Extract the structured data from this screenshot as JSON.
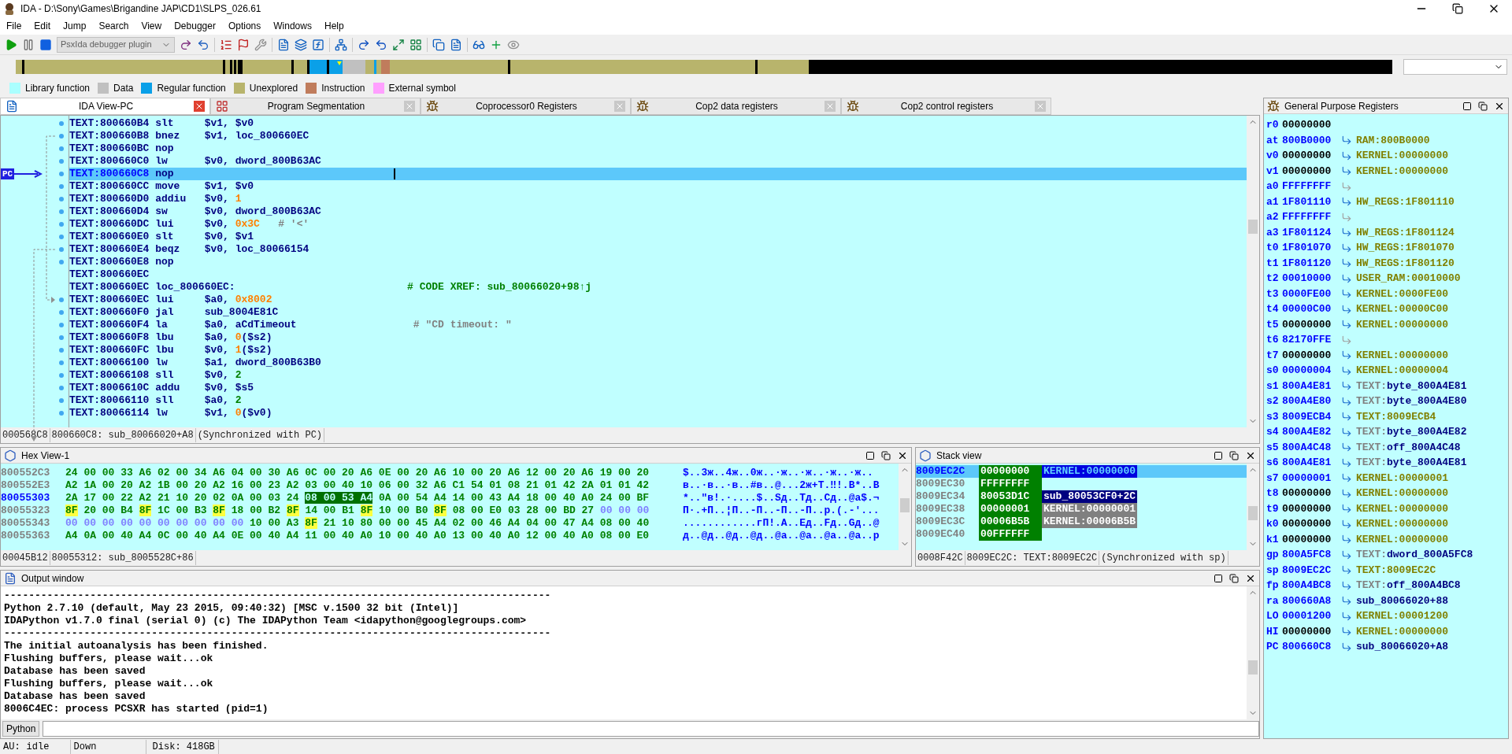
{
  "window": {
    "title": "IDA - D:\\Sony\\Games\\Brigandine JAP\\CD1\\SLPS_026.61"
  },
  "menu": [
    "File",
    "Edit",
    "Jump",
    "Search",
    "View",
    "Debugger",
    "Options",
    "Windows",
    "Help"
  ],
  "toolbar": {
    "debugger_select": {
      "value": "PsxIda debugger plugin",
      "disabled": true
    }
  },
  "legend": [
    {
      "label": "Library function",
      "color": "#aaffff"
    },
    {
      "label": "Data",
      "color": "#c0c0c0"
    },
    {
      "label": "Regular function",
      "color": "#0aa0e8"
    },
    {
      "label": "Unexplored",
      "color": "#b8b46c"
    },
    {
      "label": "Instruction",
      "color": "#c07c5c"
    },
    {
      "label": "External symbol",
      "color": "#ffa0ff"
    }
  ],
  "tabs": [
    {
      "label": "IDA View-PC",
      "selected": true,
      "kind": "disassembly"
    },
    {
      "label": "Program Segmentation",
      "selected": false,
      "kind": "segments"
    },
    {
      "label": "Coprocessor0 Registers",
      "selected": false,
      "kind": "registers"
    },
    {
      "label": "Cop2 data registers",
      "selected": false,
      "kind": "registers"
    },
    {
      "label": "Cop2 control registers",
      "selected": false,
      "kind": "registers"
    }
  ],
  "disassembly": {
    "pc_label": "PC",
    "lines": [
      {
        "address": "TEXT:800660B4",
        "mnemonic": "slt",
        "operands": [
          {
            "text": "$v1, $v0",
            "kind": "text"
          }
        ],
        "selected": false
      },
      {
        "address": "TEXT:800660B8",
        "mnemonic": "bnez",
        "operands": [
          {
            "text": "$v1, loc_800660EC",
            "kind": "text"
          }
        ],
        "selected": false
      },
      {
        "address": "TEXT:800660BC",
        "mnemonic": "nop",
        "selected": false
      },
      {
        "address": "TEXT:800660C0",
        "mnemonic": "lw",
        "operands": [
          {
            "text": "$v0, dword_800B63AC",
            "kind": "text"
          }
        ],
        "selected": false
      },
      {
        "address": "TEXT:800660C8",
        "mnemonic": "nop",
        "selected": true
      },
      {
        "address": "TEXT:800660CC",
        "mnemonic": "move",
        "operands": [
          {
            "text": "$v1, $v0",
            "kind": "text"
          }
        ],
        "selected": false
      },
      {
        "address": "TEXT:800660D0",
        "mnemonic": "addiu",
        "operands": [
          {
            "text": "$v0, ",
            "kind": "text"
          },
          {
            "text": "1",
            "kind": "number"
          }
        ],
        "selected": false
      },
      {
        "address": "TEXT:800660D4",
        "mnemonic": "sw",
        "operands": [
          {
            "text": "$v0, dword_800B63AC",
            "kind": "text"
          }
        ],
        "selected": false
      },
      {
        "address": "TEXT:800660DC",
        "mnemonic": "lui",
        "operands": [
          {
            "text": "$v0, ",
            "kind": "text"
          },
          {
            "text": "0x3C",
            "kind": "number"
          }
        ],
        "comment": {
          "text": "# '<'",
          "kind": "char"
        },
        "selected": false
      },
      {
        "address": "TEXT:800660E0",
        "mnemonic": "slt",
        "operands": [
          {
            "text": "$v0, $v1",
            "kind": "text"
          }
        ],
        "selected": false
      },
      {
        "address": "TEXT:800660E4",
        "mnemonic": "beqz",
        "operands": [
          {
            "text": "$v0, loc_80066154",
            "kind": "text"
          }
        ],
        "selected": false
      },
      {
        "address": "TEXT:800660E8",
        "mnemonic": "nop",
        "selected": false
      },
      {
        "address": "TEXT:800660EC",
        "selected": false
      },
      {
        "address": "TEXT:800660EC",
        "label": "loc_800660EC:",
        "comment": {
          "text": "# CODE XREF: sub_80066020+98↑j",
          "kind": "xref"
        },
        "selected": false
      },
      {
        "address": "TEXT:800660EC",
        "mnemonic": "lui",
        "operands": [
          {
            "text": "$a0, ",
            "kind": "text"
          },
          {
            "text": "0x8002",
            "kind": "number"
          }
        ],
        "selected": false
      },
      {
        "address": "TEXT:800660F0",
        "mnemonic": "jal",
        "operands": [
          {
            "text": "sub_8004E81C",
            "kind": "text"
          }
        ],
        "selected": false
      },
      {
        "address": "TEXT:800660F4",
        "mnemonic": "la",
        "operands": [
          {
            "text": "$a0, aCdTimeout",
            "kind": "text"
          }
        ],
        "comment": {
          "text": "# \"CD timeout: \"",
          "kind": "string"
        },
        "selected": false
      },
      {
        "address": "TEXT:800660F8",
        "mnemonic": "lbu",
        "operands": [
          {
            "text": "$a0, ",
            "kind": "text"
          },
          {
            "text": "0",
            "kind": "number"
          },
          {
            "text": "($s2)",
            "kind": "text"
          }
        ],
        "selected": false
      },
      {
        "address": "TEXT:800660FC",
        "mnemonic": "lbu",
        "operands": [
          {
            "text": "$v0, ",
            "kind": "text"
          },
          {
            "text": "1",
            "kind": "number"
          },
          {
            "text": "($s2)",
            "kind": "text"
          }
        ],
        "selected": false
      },
      {
        "address": "TEXT:80066100",
        "mnemonic": "lw",
        "operands": [
          {
            "text": "$a1, dword_800B63B0",
            "kind": "text"
          }
        ],
        "selected": false
      },
      {
        "address": "TEXT:80066108",
        "mnemonic": "sll",
        "operands": [
          {
            "text": "$v0, ",
            "kind": "text"
          },
          {
            "text": "2",
            "kind": "decimal"
          }
        ],
        "selected": false
      },
      {
        "address": "TEXT:8006610C",
        "mnemonic": "addu",
        "operands": [
          {
            "text": "$v0, $s5",
            "kind": "text"
          }
        ],
        "selected": false
      },
      {
        "address": "TEXT:80066110",
        "mnemonic": "sll",
        "operands": [
          {
            "text": "$a0, ",
            "kind": "text"
          },
          {
            "text": "2",
            "kind": "decimal"
          }
        ],
        "selected": false
      },
      {
        "address": "TEXT:80066114",
        "mnemonic": "lw",
        "operands": [
          {
            "text": "$v1, ",
            "kind": "text"
          },
          {
            "text": "0",
            "kind": "number"
          },
          {
            "text": "($v0)",
            "kind": "text"
          }
        ],
        "selected": false
      }
    ],
    "status": [
      "000568C8",
      "800660C8: sub_80066020+A8",
      "(Synchronized with PC)"
    ]
  },
  "hex_view": {
    "title": "Hex View-1",
    "rows": [
      {
        "address": "800552C3",
        "current": false,
        "groups": [
          {
            "text": "24 00 00 33 A6 02 00 34 A6 04 00 30 A6 0C 00 20 A6 0E 00 20 A6 10 00 20 A6 12 00 20 A6 19 00 20",
            "kind": "plain"
          }
        ],
        "ascii": "$..3ж..4ж..0ж..·ж..·ж..·ж..·ж.."
      },
      {
        "address": "800552E3",
        "current": false,
        "groups": [
          {
            "text": "A2 1A 00 20 A2 1B 00 20 A2 16 00 23 A2 03 00 40 10 06 00 32 A6 C1 54 01 08 21 01 42 2A 01 01 42",
            "kind": "plain"
          }
        ],
        "ascii": "в..·в..·в..#в..@...2ж+T.‼!.B*..B"
      },
      {
        "address": "80055303",
        "current": true,
        "groups": [
          {
            "text": "2A 17 00 22 A2 21 10 20 02 0A 00 03 24",
            "kind": "plain"
          },
          {
            "text": "08 00 53 A4",
            "kind": "selected"
          },
          {
            "text": "0A 00 54 A4 14 00 43 A4 18 00 40 A0 24 00 BF",
            "kind": "plain"
          }
        ],
        "ascii": "*..\"в!.·....$..Sд..Тд..Сд..@а$.¬"
      },
      {
        "address": "80055323",
        "current": false,
        "groups": [
          {
            "text": "8F",
            "kind": "patched"
          },
          {
            "text": "20 00 B4",
            "kind": "plain"
          },
          {
            "text": "8F",
            "kind": "patched"
          },
          {
            "text": "1C 00 B3",
            "kind": "plain"
          },
          {
            "text": "8F",
            "kind": "patched"
          },
          {
            "text": "18 00 B2",
            "kind": "plain"
          },
          {
            "text": "8F",
            "kind": "patched"
          },
          {
            "text": "14 00 B1",
            "kind": "plain"
          },
          {
            "text": "8F",
            "kind": "patched"
          },
          {
            "text": "10 00 B0",
            "kind": "plain"
          },
          {
            "text": "8F",
            "kind": "patched"
          },
          {
            "text": "08 00 E0 03 28 00 BD 27",
            "kind": "plain"
          },
          {
            "text": "00 00 00",
            "kind": "unexplored"
          }
        ],
        "ascii": "П·.+П..¦П..-П..-П..-П..р.(.-'..."
      },
      {
        "address": "80055343",
        "current": false,
        "groups": [
          {
            "text": "00 00 00 00 00 00 00 00 00 00",
            "kind": "unexplored"
          },
          {
            "text": "10 00 A3",
            "kind": "plain"
          },
          {
            "text": "8F",
            "kind": "patched"
          },
          {
            "text": "21 10 80 00 00 45 A4 02 00 46 A4 04 00 47 A4 08 00 40",
            "kind": "plain"
          }
        ],
        "ascii": "............гП!.А..Ед..Fд..Gд..@"
      },
      {
        "address": "80055363",
        "current": false,
        "groups": [
          {
            "text": "A4 0A 00 40 A4 0C 00 40 A4 0E 00 40 A4 11 00 40 A0 10 00 40 A0 13 00 40 A0 12 00 40 A0 08 00 E0",
            "kind": "plain"
          }
        ],
        "ascii": "д..@д..@д..@д..@а..@а..@а..@а..р"
      }
    ],
    "status": [
      "00045B12",
      "80055312: sub_8005528C+86"
    ]
  },
  "stack_view": {
    "title": "Stack view",
    "rows": [
      {
        "address": "8009EC2C",
        "value": "00000000",
        "target": {
          "text": "KERNEL:00000000",
          "kind": "data"
        },
        "selected": true
      },
      {
        "address": "8009EC30",
        "value": "FFFFFFFF",
        "selected": false
      },
      {
        "address": "8009EC34",
        "value": "80053D1C",
        "target": {
          "text": "sub_80053CF0+2C",
          "kind": "code"
        },
        "selected": false
      },
      {
        "address": "8009EC38",
        "value": "00000001",
        "target": {
          "text": "KERNEL:00000001",
          "kind": "data"
        },
        "selected": false
      },
      {
        "address": "8009EC3C",
        "value": "00006B5B",
        "target": {
          "text": "KERNEL:00006B5B",
          "kind": "data"
        },
        "selected": false
      },
      {
        "address": "8009EC40",
        "value": "00FFFFFF",
        "selected": false
      }
    ],
    "status": [
      "0008F42C",
      "8009EC2C: TEXT:8009EC2C",
      "(Synchronized with sp)"
    ]
  },
  "output": {
    "title": "Output window",
    "lines": [
      "-----------------------------------------------------------------------------------------",
      "Python 2.7.10 (default, May 23 2015, 09:40:32) [MSC v.1500 32 bit (Intel)]",
      "IDAPython v1.7.0 final (serial 0) (c) The IDAPython Team <idapython@googlegroups.com>",
      "-----------------------------------------------------------------------------------------",
      "The initial autoanalysis has been finished.",
      "Flushing buffers, please wait...ok",
      "Database has been saved",
      "Flushing buffers, please wait...ok",
      "Database has been saved",
      "8006C4EC: process PCSXR has started (pid=1)"
    ]
  },
  "command_bar": {
    "language": "Python"
  },
  "registers": {
    "title": "General Purpose Registers",
    "rows": [
      {
        "name": "r0",
        "value": "00000000",
        "changed": false
      },
      {
        "name": "at",
        "value": "800B0000",
        "changed": true,
        "target": {
          "text": "RAM:800B0000",
          "kind": "data"
        }
      },
      {
        "name": "v0",
        "value": "00000000",
        "changed": false,
        "target": {
          "text": "KERNEL:00000000",
          "kind": "data"
        }
      },
      {
        "name": "v1",
        "value": "00000000",
        "changed": false,
        "target": {
          "text": "KERNEL:00000000",
          "kind": "data"
        }
      },
      {
        "name": "a0",
        "value": "FFFFFFFF",
        "changed": true,
        "target": {
          "kind": "none"
        }
      },
      {
        "name": "a1",
        "value": "1F801110",
        "changed": true,
        "target": {
          "text": "HW_REGS:1F801110",
          "kind": "data"
        }
      },
      {
        "name": "a2",
        "value": "FFFFFFFF",
        "changed": true,
        "target": {
          "kind": "none"
        }
      },
      {
        "name": "a3",
        "value": "1F801124",
        "changed": true,
        "target": {
          "text": "HW_REGS:1F801124",
          "kind": "data"
        }
      },
      {
        "name": "t0",
        "value": "1F801070",
        "changed": true,
        "target": {
          "text": "HW_REGS:1F801070",
          "kind": "data"
        }
      },
      {
        "name": "t1",
        "value": "1F801120",
        "changed": true,
        "target": {
          "text": "HW_REGS:1F801120",
          "kind": "data"
        }
      },
      {
        "name": "t2",
        "value": "00010000",
        "changed": true,
        "target": {
          "text": "USER_RAM:00010000",
          "kind": "data"
        }
      },
      {
        "name": "t3",
        "value": "0000FE00",
        "changed": true,
        "target": {
          "text": "KERNEL:0000FE00",
          "kind": "data"
        }
      },
      {
        "name": "t4",
        "value": "00000C00",
        "changed": true,
        "target": {
          "text": "KERNEL:00000C00",
          "kind": "data"
        }
      },
      {
        "name": "t5",
        "value": "00000000",
        "changed": false,
        "target": {
          "text": "KERNEL:00000000",
          "kind": "data"
        }
      },
      {
        "name": "t6",
        "value": "82170FFE",
        "changed": true,
        "target": {
          "kind": "none"
        }
      },
      {
        "name": "t7",
        "value": "00000000",
        "changed": false,
        "target": {
          "text": "KERNEL:00000000",
          "kind": "data"
        }
      },
      {
        "name": "s0",
        "value": "00000004",
        "changed": true,
        "target": {
          "text": "KERNEL:00000004",
          "kind": "data"
        }
      },
      {
        "name": "s1",
        "value": "800A4E81",
        "changed": true,
        "target": {
          "segment": "TEXT:",
          "text": "byte_800A4E81",
          "kind": "named"
        }
      },
      {
        "name": "s2",
        "value": "800A4E80",
        "changed": true,
        "target": {
          "segment": "TEXT:",
          "text": "byte_800A4E80",
          "kind": "named"
        }
      },
      {
        "name": "s3",
        "value": "8009ECB4",
        "changed": true,
        "target": {
          "text": "TEXT:8009ECB4",
          "kind": "data"
        }
      },
      {
        "name": "s4",
        "value": "800A4E82",
        "changed": true,
        "target": {
          "segment": "TEXT:",
          "text": "byte_800A4E82",
          "kind": "named"
        }
      },
      {
        "name": "s5",
        "value": "800A4C48",
        "changed": true,
        "target": {
          "segment": "TEXT:",
          "text": "off_800A4C48",
          "kind": "named"
        }
      },
      {
        "name": "s6",
        "value": "800A4E81",
        "changed": true,
        "target": {
          "segment": "TEXT:",
          "text": "byte_800A4E81",
          "kind": "named"
        }
      },
      {
        "name": "s7",
        "value": "00000001",
        "changed": true,
        "target": {
          "text": "KERNEL:00000001",
          "kind": "data"
        }
      },
      {
        "name": "t8",
        "value": "00000000",
        "changed": false,
        "target": {
          "text": "KERNEL:00000000",
          "kind": "data"
        }
      },
      {
        "name": "t9",
        "value": "00000000",
        "changed": false,
        "target": {
          "text": "KERNEL:00000000",
          "kind": "data"
        }
      },
      {
        "name": "k0",
        "value": "00000000",
        "changed": false,
        "target": {
          "text": "KERNEL:00000000",
          "kind": "data"
        }
      },
      {
        "name": "k1",
        "value": "00000000",
        "changed": false,
        "target": {
          "text": "KERNEL:00000000",
          "kind": "data"
        }
      },
      {
        "name": "gp",
        "value": "800A5FC8",
        "changed": true,
        "target": {
          "segment": "TEXT:",
          "text": "dword_800A5FC8",
          "kind": "named"
        }
      },
      {
        "name": "sp",
        "value": "8009EC2C",
        "changed": true,
        "target": {
          "text": "TEXT:8009EC2C",
          "kind": "data"
        }
      },
      {
        "name": "fp",
        "value": "800A4BC8",
        "changed": true,
        "target": {
          "segment": "TEXT:",
          "text": "off_800A4BC8",
          "kind": "named"
        }
      },
      {
        "name": "ra",
        "value": "800660A8",
        "changed": true,
        "target": {
          "text": "sub_80066020+88",
          "kind": "code"
        }
      },
      {
        "name": "LO",
        "value": "00001200",
        "changed": true,
        "target": {
          "text": "KERNEL:00001200",
          "kind": "data"
        }
      },
      {
        "name": "HI",
        "value": "00000000",
        "changed": false,
        "target": {
          "text": "KERNEL:00000000",
          "kind": "data"
        }
      },
      {
        "name": "PC",
        "value": "800660C8",
        "changed": true,
        "target": {
          "text": "sub_80066020+A8",
          "kind": "code"
        }
      }
    ]
  },
  "status_bar": {
    "au_label": "AU:",
    "au_state": "idle",
    "direction": "Down",
    "disk": "Disk: 418GB"
  }
}
